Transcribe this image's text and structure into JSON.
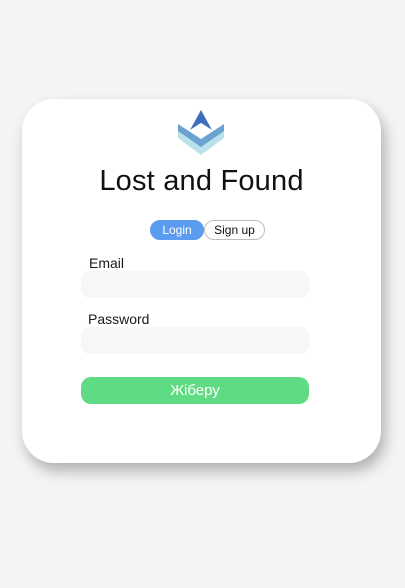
{
  "app": {
    "title": "Lost and Found",
    "logo_icon": "layered-arrow-logo-icon"
  },
  "tabs": {
    "login_label": "Login",
    "signup_label": "Sign up",
    "active": "login"
  },
  "form": {
    "email_label": "Email",
    "email_value": "",
    "password_label": "Password",
    "password_value": "",
    "submit_label": "Жіберу"
  },
  "colors": {
    "page_background": "#f4f4f4",
    "card_background": "#ffffff",
    "tab_active": "#5b9cf0",
    "submit_button": "#5fdb84",
    "input_background": "#f7f7f7",
    "logo_top": "#3e6fbf",
    "logo_middle": "#6aa3cf",
    "logo_bottom": "#b9e2ea"
  }
}
